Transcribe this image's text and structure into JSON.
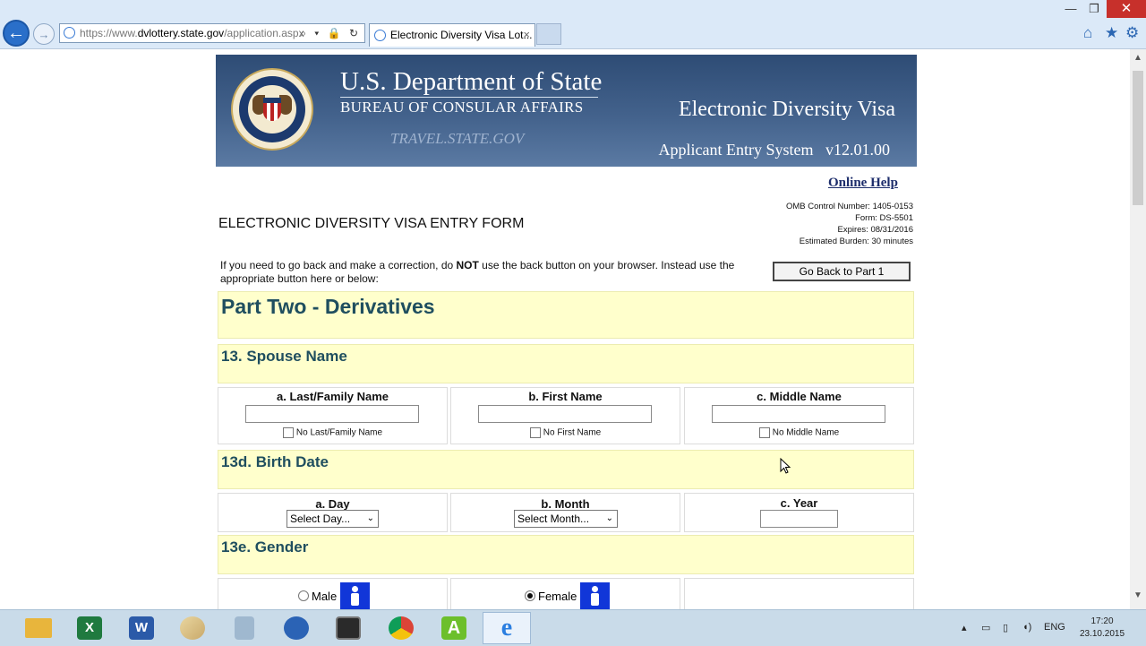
{
  "window": {
    "min_glyph": "—",
    "max_glyph": "❐",
    "close_glyph": "✕"
  },
  "browser": {
    "url_prefix": "https://www.",
    "url_domain": "dvlottery.state.gov",
    "url_path": "/application.aspx",
    "addr_tools": "⌕ ▾ 🔒 ↻",
    "tab_title": "Electronic Diversity Visa Lot...",
    "tab_close": "×",
    "back_glyph": "←",
    "forward_glyph": "→",
    "home_glyph": "⌂",
    "star_glyph": "★",
    "gear_glyph": "⚙"
  },
  "banner": {
    "title": "U.S. Department of State",
    "subtitle": "BUREAU OF CONSULAR AFFAIRS",
    "travel": "TRAVEL.STATE.GOV",
    "edv": "Electronic Diversity Visa",
    "aes": "Applicant Entry System   v12.01.00",
    "seal_text": "DEPARTMENT OF STATE · UNITED STATES OF AMERICA"
  },
  "page": {
    "online_help": "Online Help",
    "form_title": "ELECTRONIC DIVERSITY VISA ENTRY FORM",
    "omb": [
      "OMB Control Number: 1405-0153",
      "Form: DS-5501",
      "Expires: 08/31/2016",
      "Estimated Burden: 30 minutes"
    ],
    "instr_a": "If you need to go back and make a correction, do ",
    "instr_b": "NOT",
    "instr_c": " use the back button on your browser. Instead use the appropriate button here or below:",
    "go_back": "Go Back to Part 1"
  },
  "part": {
    "heading": "Part Two - Derivatives"
  },
  "spouse": {
    "heading": "13. Spouse Name",
    "last_label": "a. Last/Family Name",
    "first_label": "b. First Name",
    "middle_label": "c. Middle Name",
    "last_value": "",
    "first_value": "",
    "middle_value": "",
    "no_last": "No Last/Family Name",
    "no_first": "No First Name",
    "no_middle": "No Middle Name"
  },
  "birth": {
    "heading": "13d. Birth Date",
    "day_label": "a. Day",
    "month_label": "b. Month",
    "year_label": "c. Year",
    "day_selected": "Select Day...",
    "month_selected": "Select Month...",
    "year_value": "",
    "select_arrow": "⌄"
  },
  "gender": {
    "heading": "13e. Gender",
    "male": "Male",
    "female": "Female",
    "selected": "Female"
  },
  "taskbar": {
    "apps": [
      "file-explorer",
      "excel",
      "word",
      "paint",
      "calculator",
      "app-refresh",
      "media-player",
      "chrome",
      "green-a-app",
      "internet-explorer"
    ],
    "excel_letter": "X",
    "word_letter": "W",
    "a_letter": "A",
    "ie_letter": "e",
    "tray_arrow": "▴",
    "lang": "ENG",
    "time": "17:20",
    "date": "23.10.2015"
  }
}
